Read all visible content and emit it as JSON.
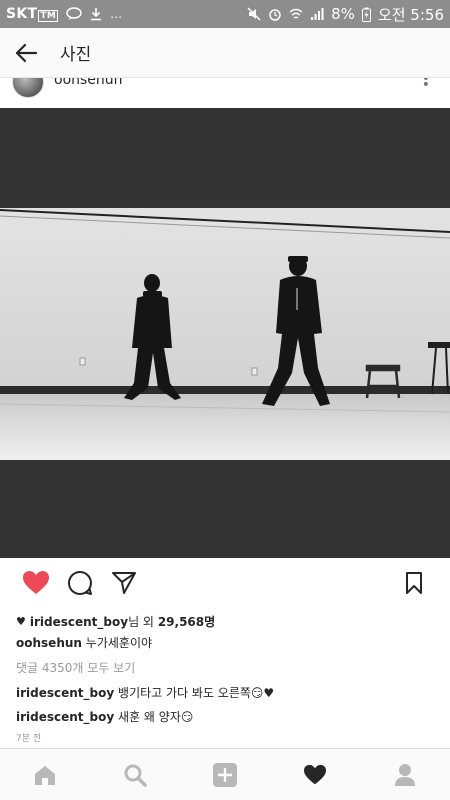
{
  "status_bar": {
    "carrier": "SKT",
    "carrier_badge": "TM",
    "battery": "8%",
    "time": "오전 5:56",
    "left_icons": [
      "kakao-talk-icon",
      "download-icon",
      "ellipsis-icon"
    ],
    "right_icons": [
      "mute-icon",
      "alarm-icon",
      "wifi-icon",
      "signal-icon",
      "battery-charging-icon"
    ]
  },
  "header": {
    "title": "사진"
  },
  "post": {
    "author": "oohsehun"
  },
  "actions": {
    "liked": true,
    "like_color": "#ed4956"
  },
  "meta": {
    "liked_by_user": "iridescent_boy",
    "liked_by_suffix": "님 외",
    "likes_count": "29,568명",
    "caption_user": "oohsehun",
    "caption_text": "누가세훈이야",
    "view_comments": "댓글 4350개 모두 보기",
    "comments": [
      {
        "user": "iridescent_boy",
        "text": "뱅기타고 가다 봐도 오른쪽😏♥"
      },
      {
        "user": "iridescent_boy",
        "text": "새훈 왜 양자😏"
      }
    ],
    "timestamp": "7분 전"
  },
  "bottom_nav": {
    "items": [
      "home-icon",
      "search-icon",
      "add-post-icon",
      "activity-heart-icon",
      "profile-icon"
    ],
    "active": "activity-heart-icon"
  },
  "colors": {
    "status_bar": "#8d8d8d",
    "photo_frame": "#333333",
    "like_red": "#ed4956"
  }
}
